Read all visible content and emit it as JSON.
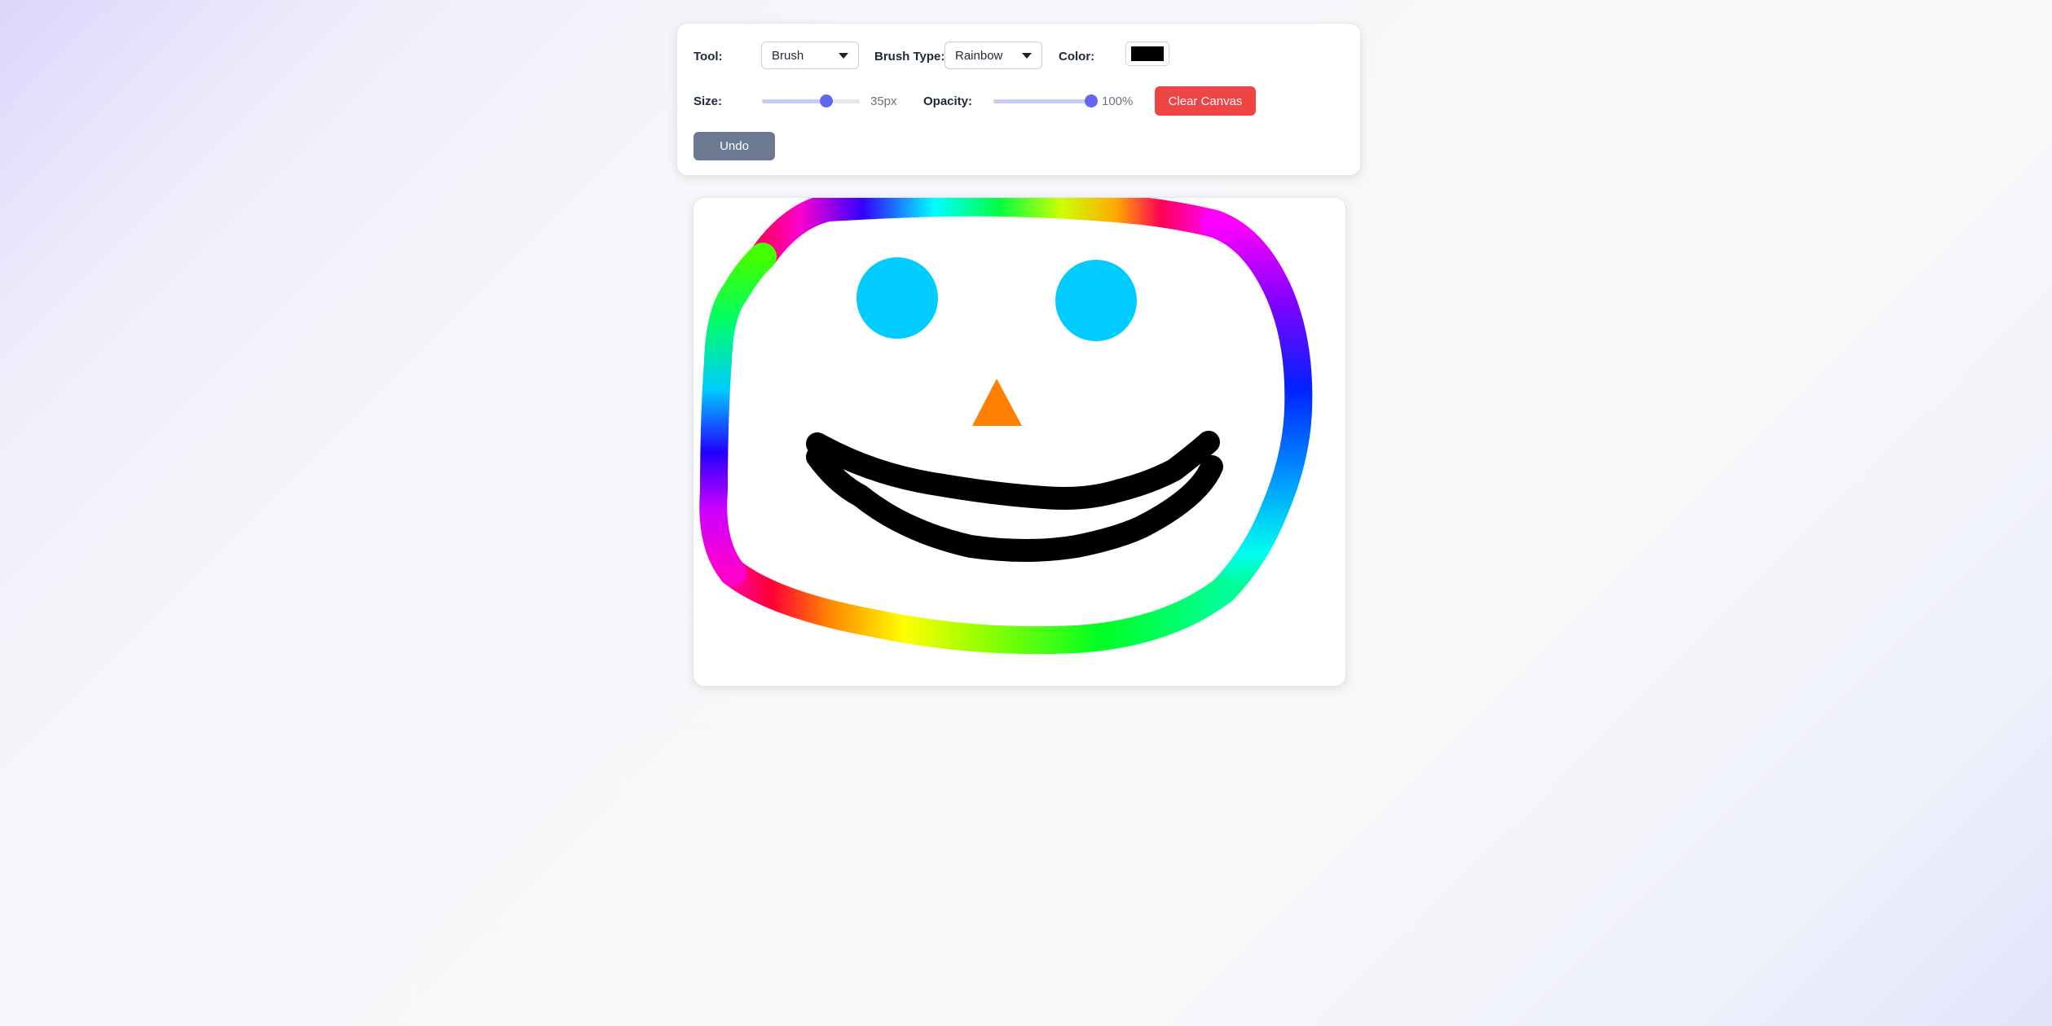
{
  "toolbar": {
    "tool_label": "Tool:",
    "tool_value": "Brush",
    "brush_type_label": "Brush Type:",
    "brush_type_value": "Rainbow",
    "color_label": "Color:",
    "color_value": "#000000",
    "size_label": "Size:",
    "size_value": "35px",
    "size_fraction": 0.66,
    "opacity_label": "Opacity:",
    "opacity_value": "100%",
    "opacity_fraction": 1.0,
    "clear_label": "Clear Canvas",
    "undo_label": "Undo"
  },
  "colors": {
    "accent": "#6366f1",
    "clear_button": "#ef4444",
    "undo_button": "#6b7a90",
    "eyes": "#00ccff",
    "nose": "#ff7f00",
    "mouth": "#000000"
  }
}
